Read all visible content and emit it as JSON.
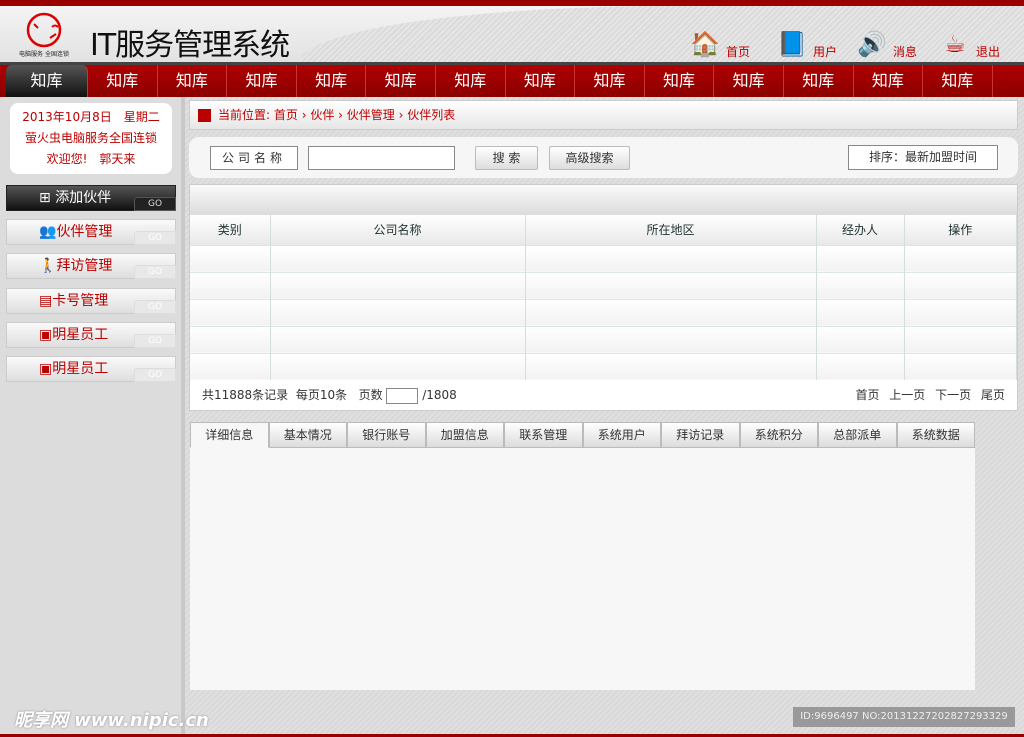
{
  "header": {
    "title": "IT服务管理系统",
    "logo_text": "萤火虫 电脑服务 全国连锁",
    "links": [
      {
        "label": "首页",
        "icon": "home-icon"
      },
      {
        "label": "用户",
        "icon": "user-book-icon"
      },
      {
        "label": "消息",
        "icon": "speaker-icon"
      },
      {
        "label": "退出",
        "icon": "coffee-exit-icon"
      }
    ]
  },
  "nav": [
    "知库",
    "知库",
    "知库",
    "知库",
    "知库",
    "知库",
    "知库",
    "知库",
    "知库",
    "知库",
    "知库",
    "知库",
    "知库",
    "知库"
  ],
  "sidebar": {
    "date": "2013年10月8日　星期二",
    "company": "萤火虫电脑服务全国连锁",
    "welcome": "欢迎您!　郭天来",
    "go": "GO",
    "items": [
      {
        "label": "添加伙伴",
        "icon": "plus-icon"
      },
      {
        "label": "伙伴管理",
        "icon": "group-icon"
      },
      {
        "label": "拜访管理",
        "icon": "visitor-icon"
      },
      {
        "label": "卡号管理",
        "icon": "card-icon"
      },
      {
        "label": "明星员工",
        "icon": "badge-icon"
      },
      {
        "label": "明星员工",
        "icon": "badge-icon"
      }
    ]
  },
  "breadcrumb": {
    "prefix": "当前位置:",
    "items": [
      "首页",
      "伙伴",
      "伙伴管理",
      "伙伴列表"
    ]
  },
  "search": {
    "label": "公司名称",
    "value": "",
    "search_btn": "搜 索",
    "advanced_btn": "高级搜索",
    "sort": "排序：最新加盟时间"
  },
  "table": {
    "columns": [
      "类别",
      "公司名称",
      "所在地区",
      "经办人",
      "操作"
    ],
    "rows": [
      [
        "",
        "",
        "",
        "",
        ""
      ],
      [
        "",
        "",
        "",
        "",
        ""
      ],
      [
        "",
        "",
        "",
        "",
        ""
      ],
      [
        "",
        "",
        "",
        "",
        ""
      ],
      [
        "",
        "",
        "",
        "",
        ""
      ]
    ]
  },
  "pager": {
    "total": "共11888条记录",
    "per_page": "每页10条",
    "page_label": "页数",
    "page_value": "",
    "total_pages": "/1808",
    "first": "首页",
    "prev": "上一页",
    "next": "下一页",
    "last": "尾页"
  },
  "tabs": [
    "详细信息",
    "基本情况",
    "银行账号",
    "加盟信息",
    "联系管理",
    "系统用户",
    "拜访记录",
    "系统积分",
    "总部派单",
    "系统数据"
  ],
  "watermark": "昵享网 www.nipic.cn",
  "image_id": "ID:9696497 NO:20131227202827293329",
  "colors": {
    "brand": "#9b0000",
    "accent_text": "#bb0000"
  }
}
